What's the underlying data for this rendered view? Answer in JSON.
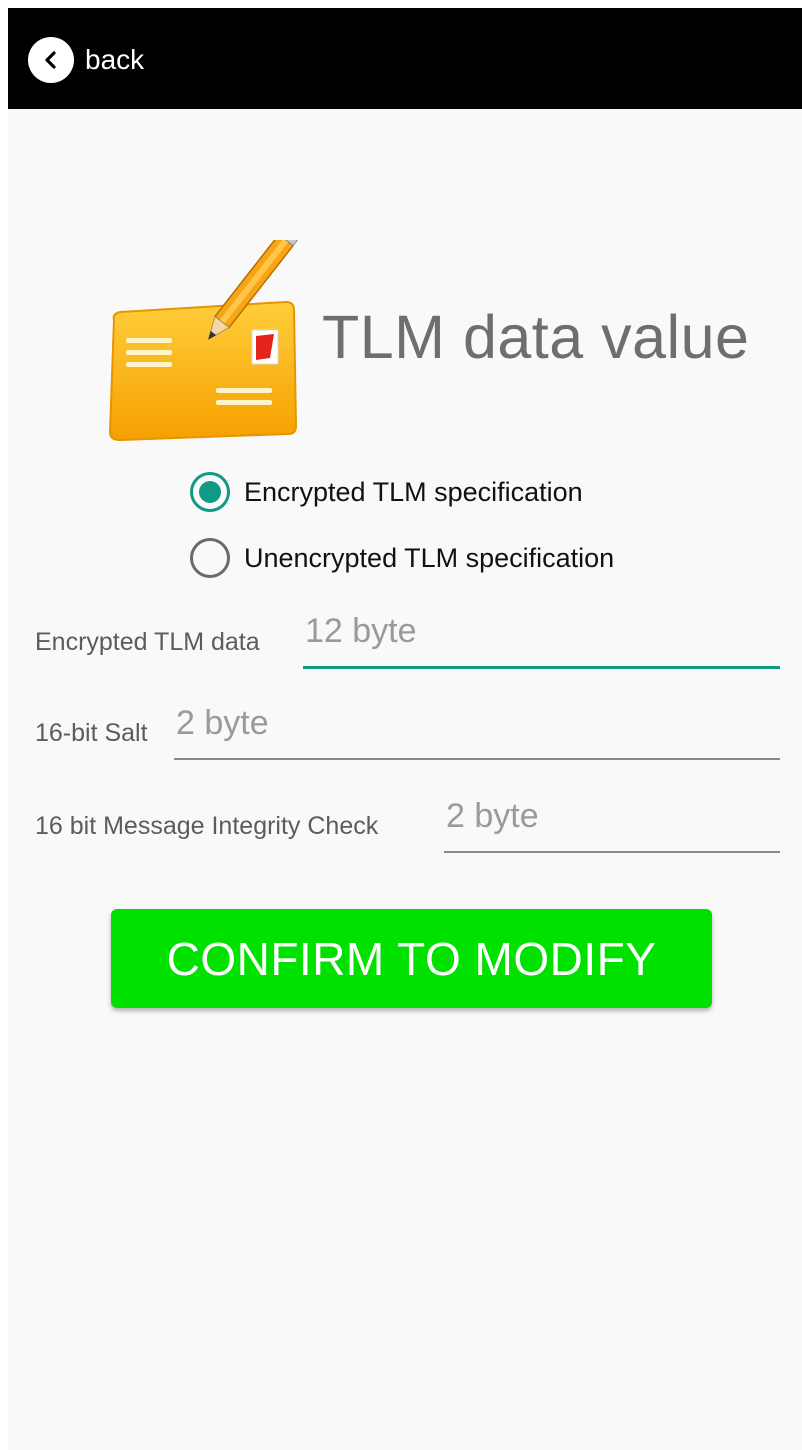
{
  "header": {
    "back_label": "back",
    "back_icon": "chevron-left-icon"
  },
  "hero": {
    "icon": "envelope-pencil-icon",
    "title": "TLM data value"
  },
  "spec_options": [
    {
      "label": "Encrypted TLM specification",
      "selected": true
    },
    {
      "label": "Unencrypted TLM specification",
      "selected": false
    }
  ],
  "fields": [
    {
      "label": "Encrypted TLM data",
      "value": "",
      "placeholder": "12 byte",
      "focused": true
    },
    {
      "label": "16-bit Salt",
      "value": "",
      "placeholder": "2 byte",
      "focused": false
    },
    {
      "label": "16 bit Message Integrity Check",
      "value": "",
      "placeholder": "2 byte",
      "focused": false
    }
  ],
  "confirm_button": {
    "label": "CONFIRM TO MODIFY",
    "color": "#00e100"
  },
  "colors": {
    "accent": "#0f9a86",
    "header_bg": "#000000"
  }
}
